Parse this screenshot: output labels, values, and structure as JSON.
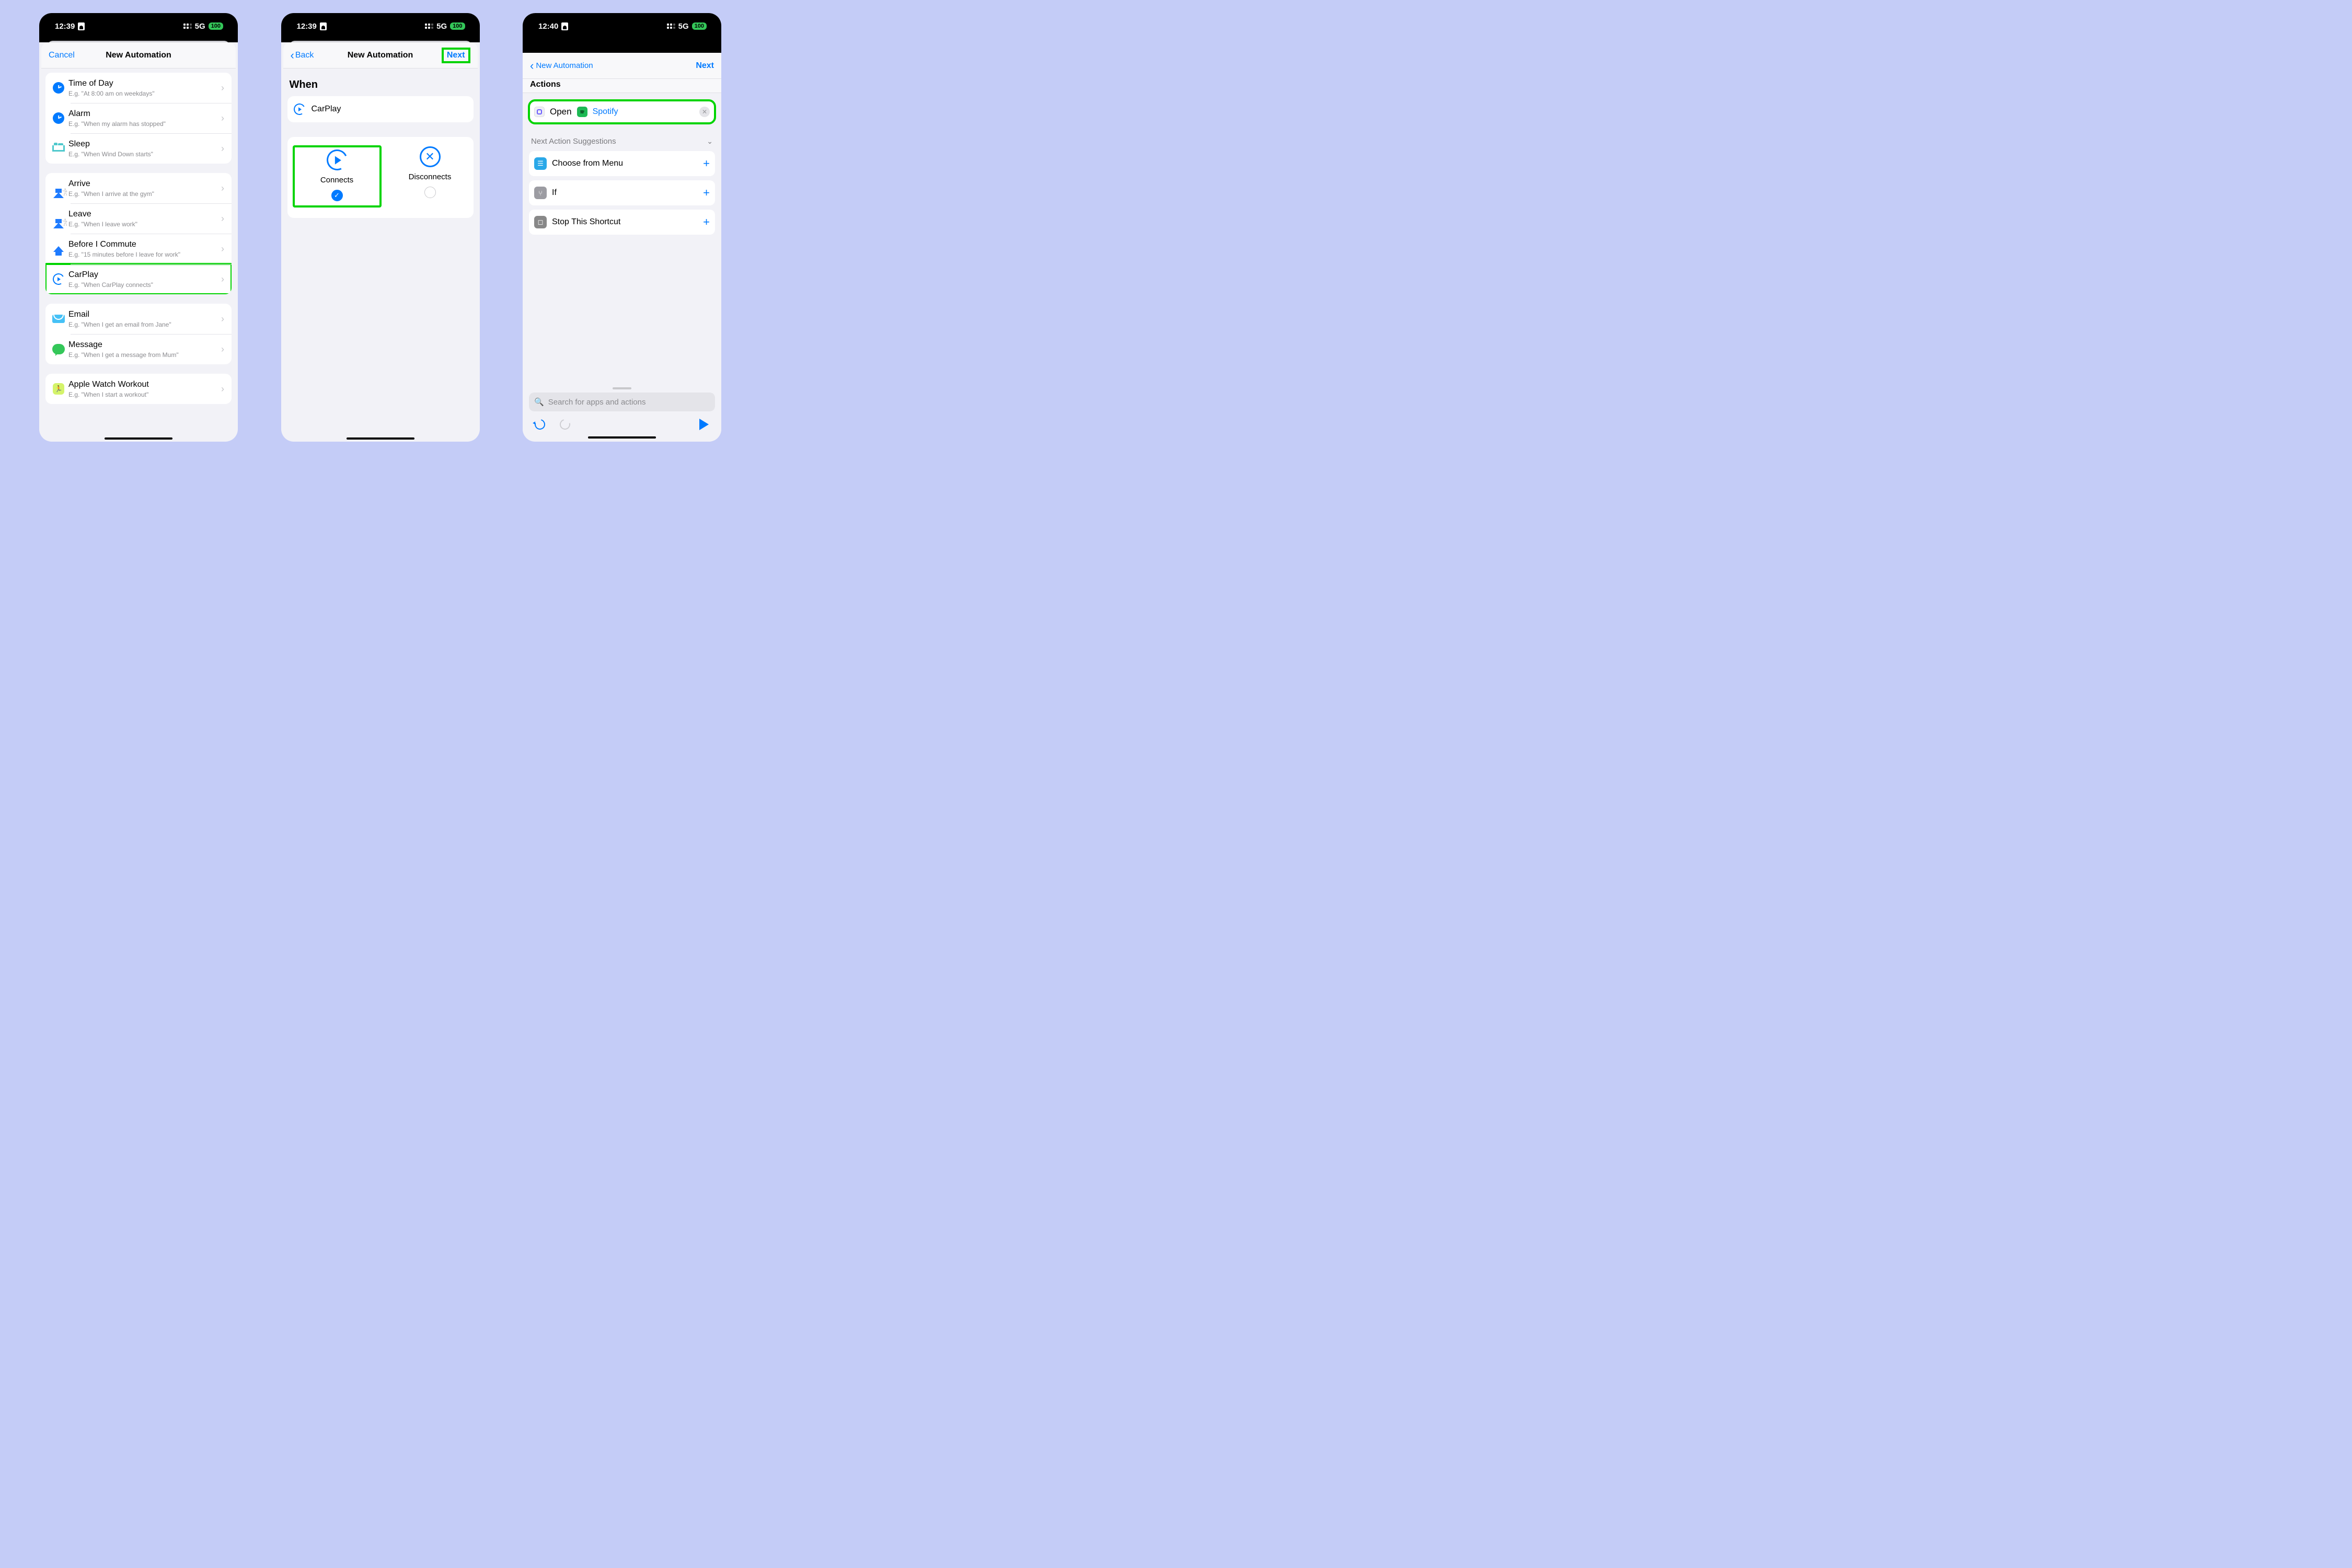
{
  "status": {
    "network": "5G",
    "battery": "100"
  },
  "screens": [
    {
      "time": "12:39",
      "nav": {
        "left": "Cancel",
        "title": "New Automation"
      },
      "groups": [
        [
          {
            "title": "Time of Day",
            "sub": "E.g. \"At 8:00 am on weekdays\"",
            "icon": "clock"
          },
          {
            "title": "Alarm",
            "sub": "E.g. \"When my alarm has stopped\"",
            "icon": "clock"
          },
          {
            "title": "Sleep",
            "sub": "E.g. \"When Wind Down starts\"",
            "icon": "bed"
          }
        ],
        [
          {
            "title": "Arrive",
            "sub": "E.g. \"When I arrive at the gym\"",
            "icon": "home-walk"
          },
          {
            "title": "Leave",
            "sub": "E.g. \"When I leave work\"",
            "icon": "home-walk"
          },
          {
            "title": "Before I Commute",
            "sub": "E.g. \"15 minutes before I leave for work\"",
            "icon": "home"
          },
          {
            "title": "CarPlay",
            "sub": "E.g. \"When CarPlay connects\"",
            "icon": "carplay",
            "highlight": true
          }
        ],
        [
          {
            "title": "Email",
            "sub": "E.g. \"When I get an email from Jane\"",
            "icon": "mail"
          },
          {
            "title": "Message",
            "sub": "E.g. \"When I get a message from Mum\"",
            "icon": "message"
          }
        ],
        [
          {
            "title": "Apple Watch Workout",
            "sub": "E.g. \"When I start a workout\"",
            "icon": "watch"
          }
        ]
      ]
    },
    {
      "time": "12:39",
      "nav": {
        "left": "Back",
        "title": "New Automation",
        "right": "Next",
        "rightHighlight": true
      },
      "when_label": "When",
      "trigger": "CarPlay",
      "choices": [
        {
          "label": "Connects",
          "icon": "connect",
          "selected": true,
          "highlight": true
        },
        {
          "label": "Disconnects",
          "icon": "x",
          "selected": false
        }
      ]
    },
    {
      "time": "12:40",
      "nav": {
        "back": "New Automation",
        "title": "Actions",
        "right": "Next"
      },
      "action": {
        "verb": "Open",
        "app": "Spotify",
        "highlight": true
      },
      "suggestions_label": "Next Action Suggestions",
      "suggestions": [
        {
          "label": "Choose from Menu",
          "icon": "menu"
        },
        {
          "label": "If",
          "icon": "if"
        },
        {
          "label": "Stop This Shortcut",
          "icon": "stop"
        }
      ],
      "search_placeholder": "Search for apps and actions"
    }
  ]
}
